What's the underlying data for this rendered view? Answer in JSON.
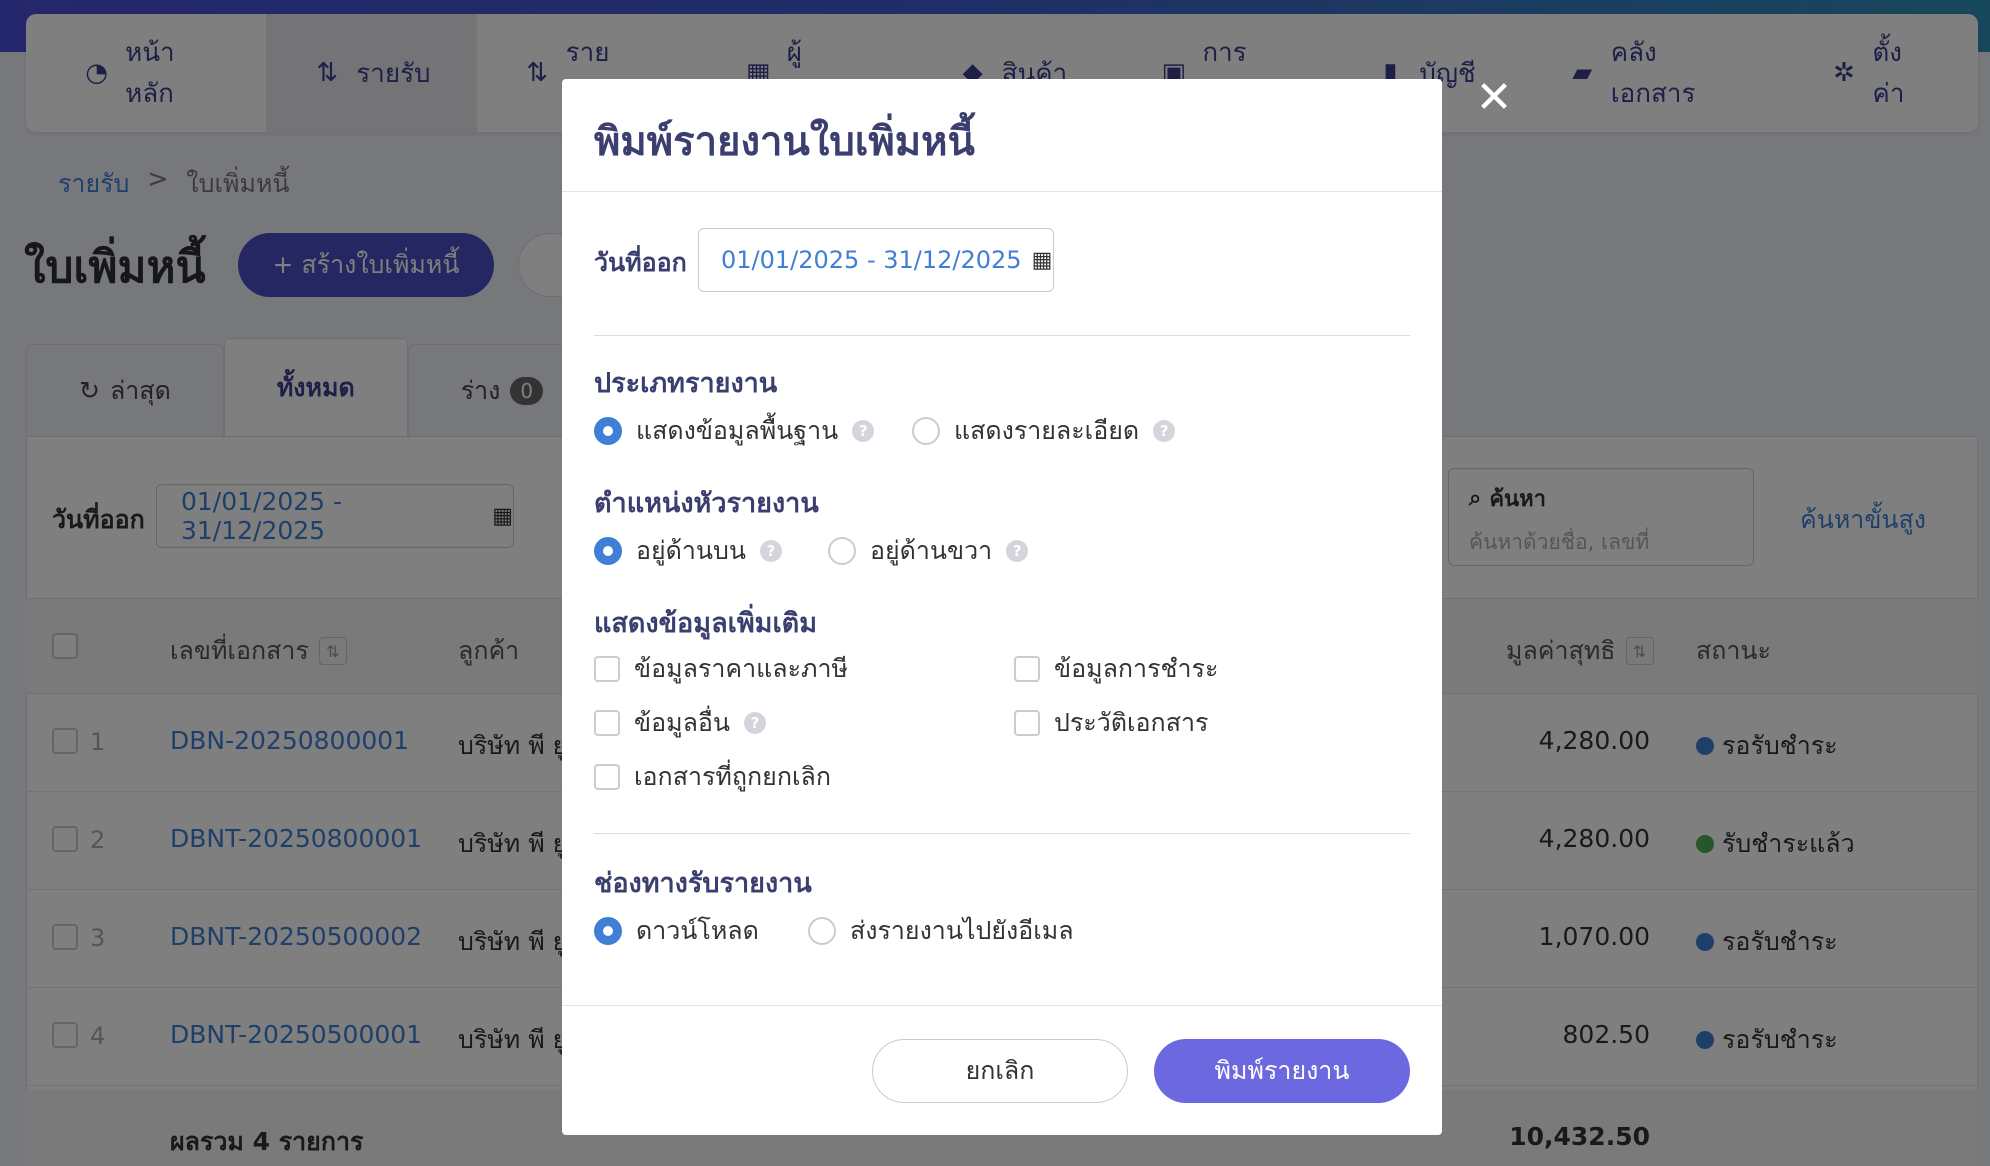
{
  "nav": [
    {
      "label": "หน้าหลัก",
      "icon": "dashboard-icon",
      "glyph": "◔"
    },
    {
      "label": "รายรับ",
      "icon": "income-icon",
      "glyph": "⇅"
    },
    {
      "label": "รายจ่าย",
      "icon": "expense-icon",
      "glyph": "⇅"
    },
    {
      "label": "ผู้ติดต่อ",
      "icon": "contacts-icon",
      "glyph": "▦"
    },
    {
      "label": "สินค้า",
      "icon": "box-icon",
      "glyph": "◆"
    },
    {
      "label": "การเงิน",
      "icon": "money-icon",
      "glyph": "▣"
    },
    {
      "label": "บัญชี",
      "icon": "book-icon",
      "glyph": "▮"
    },
    {
      "label": "คลังเอกสาร",
      "icon": "folder-icon",
      "glyph": "▰"
    },
    {
      "label": "ตั้งค่า",
      "icon": "gear-icon",
      "glyph": "✲"
    }
  ],
  "breadcrumb": {
    "parent": "รายรับ",
    "separator": ">",
    "current": "ใบเพิ่มหนี้"
  },
  "page": {
    "title": "ใบเพิ่มหนี้",
    "create_label": "+ สร้างใบเพิ่มหนี้"
  },
  "tabs": [
    {
      "label": "ล่าสุด",
      "icon": "↻"
    },
    {
      "label": "ทั้งหมด"
    },
    {
      "label": "ร่าง",
      "count": "0"
    }
  ],
  "filter": {
    "label": "วันที่ออก",
    "date_range": "01/01/2025 - 31/12/2025"
  },
  "search": {
    "title": "ค้นหา",
    "placeholder": "ค้นหาด้วยชื่อ, เลขที่",
    "advanced": "ค้นหาขั้นสูง"
  },
  "table": {
    "headers": {
      "doc_no": "เลขที่เอกสาร",
      "customer": "ลูกค้า",
      "net": "มูลค่าสุทธิ",
      "status": "สถานะ"
    },
    "rows": [
      {
        "num": "1",
        "doc": "DBN-20250800001",
        "customer": "บริษัท พี ยู",
        "amount": "4,280.00",
        "status": "รอรับชำระ",
        "status_color": "#3f7fd6"
      },
      {
        "num": "2",
        "doc": "DBNT-20250800001",
        "customer": "บริษัท พี ยู",
        "amount": "4,280.00",
        "status": "รับชำระแล้ว",
        "status_color": "#4caf50"
      },
      {
        "num": "3",
        "doc": "DBNT-20250500002",
        "customer": "บริษัท พี ยู",
        "amount": "1,070.00",
        "status": "รอรับชำระ",
        "status_color": "#3f7fd6"
      },
      {
        "num": "4",
        "doc": "DBNT-20250500001",
        "customer": "บริษัท พี ยู",
        "amount": "802.50",
        "status": "รอรับชำระ",
        "status_color": "#3f7fd6"
      }
    ],
    "footer": {
      "label": "ผลรวม 4 รายการ",
      "total": "10,432.50"
    }
  },
  "modal": {
    "title": "พิมพ์รายงานใบเพิ่มหนี้",
    "date_label": "วันที่ออก",
    "date_range": "01/01/2025 - 31/12/2025",
    "report_type": {
      "title": "ประเภทรายงาน",
      "options": [
        {
          "label": "แสดงข้อมูลพื้นฐาน",
          "selected": true
        },
        {
          "label": "แสดงรายละเอียด",
          "selected": false
        }
      ]
    },
    "header_position": {
      "title": "ตำแหน่งหัวรายงาน",
      "options": [
        {
          "label": "อยู่ด้านบน",
          "selected": true
        },
        {
          "label": "อยู่ด้านขวา",
          "selected": false
        }
      ]
    },
    "extra_info": {
      "title": "แสดงข้อมูลเพิ่มเติม",
      "options": [
        {
          "label": "ข้อมูลราคาและภาษี",
          "checked": false
        },
        {
          "label": "ข้อมูลการชำระ",
          "checked": false
        },
        {
          "label": "ข้อมูลอื่น",
          "checked": false
        },
        {
          "label": "ประวัติเอกสาร",
          "checked": false
        },
        {
          "label": "เอกสารที่ถูกยกเลิก",
          "checked": false
        }
      ]
    },
    "delivery": {
      "title": "ช่องทางรับรายงาน",
      "options": [
        {
          "label": "ดาวน์โหลด",
          "selected": true
        },
        {
          "label": "ส่งรายงานไปยังอีเมล",
          "selected": false
        }
      ]
    },
    "help_glyph": "?",
    "close_glyph": "✕",
    "cancel_label": "ยกเลิก",
    "print_label": "พิมพ์รายงาน"
  },
  "colors": {
    "accent": "#4b4fc4",
    "link": "#3f7fd6",
    "print_button": "#6c69e0"
  }
}
